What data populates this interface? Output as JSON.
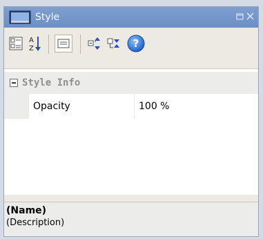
{
  "panel": {
    "title": "Style"
  },
  "toolbar": {
    "buttons": [
      {
        "name": "categorized-view-icon"
      },
      {
        "name": "alphabetical-sort-icon",
        "glyph_top": "A",
        "glyph_bottom": "Z"
      },
      {
        "name": "property-pages-icon"
      },
      {
        "name": "expand-all-icon"
      },
      {
        "name": "collapse-all-icon"
      },
      {
        "name": "help-icon",
        "glyph": "?"
      }
    ]
  },
  "grid": {
    "group_label": "Style Info",
    "properties": [
      {
        "name": "Opacity",
        "value": "100 %"
      }
    ]
  },
  "description": {
    "name": "(Name)",
    "text": "(Description)"
  },
  "colors": {
    "titlebar": "#7496cb",
    "toolbar": "#eceae2",
    "help_blue": "#2e6fd3"
  }
}
